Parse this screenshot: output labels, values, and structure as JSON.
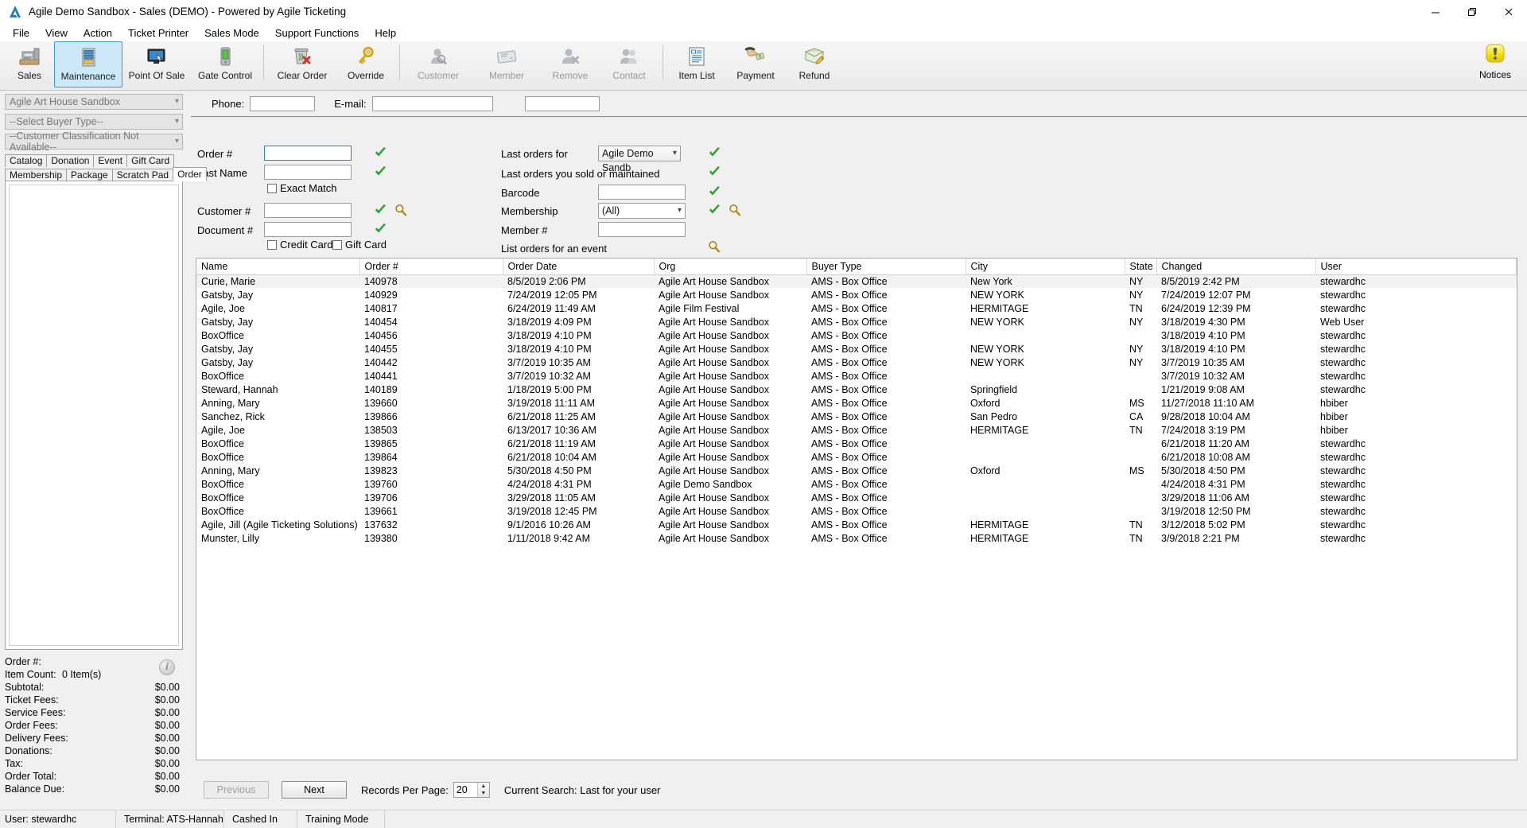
{
  "window": {
    "title": "Agile Demo Sandbox - Sales (DEMO) - Powered by Agile Ticketing",
    "minimize": "─",
    "maximize": "❐",
    "close": "✕"
  },
  "menu": {
    "items": [
      "File",
      "View",
      "Action",
      "Ticket Printer",
      "Sales Mode",
      "Support Functions",
      "Help"
    ]
  },
  "toolbar": {
    "buttons": [
      {
        "label": "Sales",
        "icon": "cash-register-icon",
        "state": "enabled"
      },
      {
        "label": "Maintenance",
        "icon": "server-cabinet-icon",
        "state": "selected"
      },
      {
        "label": "Point Of Sale",
        "icon": "monitor-touch-icon",
        "state": "enabled"
      },
      {
        "label": "Gate Control",
        "icon": "handheld-scanner-icon",
        "state": "enabled"
      },
      {
        "label": "Clear Order",
        "icon": "trash-delete-icon",
        "state": "enabled"
      },
      {
        "label": "Override",
        "icon": "key-icon",
        "state": "enabled"
      },
      {
        "label": "Customer",
        "icon": "person-search-icon",
        "state": "disabled"
      },
      {
        "label": "Member",
        "icon": "membership-card-icon",
        "state": "disabled"
      },
      {
        "label": "Remove",
        "icon": "person-remove-icon",
        "state": "disabled"
      },
      {
        "label": "Contact",
        "icon": "people-contact-icon",
        "state": "disabled"
      },
      {
        "label": "Item List",
        "icon": "document-list-icon",
        "state": "enabled"
      },
      {
        "label": "Payment",
        "icon": "hand-cash-icon",
        "state": "enabled"
      },
      {
        "label": "Refund",
        "icon": "money-pencil-icon",
        "state": "enabled"
      }
    ],
    "notices_label": "Notices"
  },
  "sidebar": {
    "combos": [
      {
        "value": "Agile Art House Sandbox",
        "name": "organization-select"
      },
      {
        "value": "--Select Buyer Type--",
        "name": "buyer-type-select"
      },
      {
        "value": "--Customer Classification Not Available--",
        "name": "customer-classification-select"
      }
    ],
    "tabs_row1": [
      "Catalog",
      "Donation",
      "Event",
      "Gift Card"
    ],
    "tabs_row2": [
      "Membership",
      "Package",
      "Scratch Pad",
      "Order"
    ],
    "active_tab": "Order"
  },
  "totals": {
    "order_number_label": "Order #:",
    "order_number_value": "",
    "item_count_label": "Item Count:",
    "item_count_value": "0 Item(s)",
    "rows": [
      {
        "label": "Subtotal:",
        "value": "$0.00"
      },
      {
        "label": "Ticket Fees:",
        "value": "$0.00"
      },
      {
        "label": "Service Fees:",
        "value": "$0.00"
      },
      {
        "label": "Order Fees:",
        "value": "$0.00"
      },
      {
        "label": "Delivery Fees:",
        "value": "$0.00"
      },
      {
        "label": "Donations:",
        "value": "$0.00"
      },
      {
        "label": "Tax:",
        "value": "$0.00"
      },
      {
        "label": "Order Total:",
        "value": "$0.00"
      },
      {
        "label": "Balance Due:",
        "value": "$0.00"
      }
    ],
    "info_glyph": "i"
  },
  "search": {
    "phone_label": "Phone:",
    "phone_value": "",
    "email_label": "E-mail:",
    "email_value": "",
    "extra_value": "",
    "order_label": "Order #",
    "order_value": "",
    "lastname_label": "Last Name",
    "lastname_value": "",
    "exact_match_label": "Exact Match",
    "customer_label": "Customer #",
    "customer_value": "",
    "document_label": "Document #",
    "document_value": "",
    "credit_card_label": "Credit Card",
    "gift_card_label": "Gift Card",
    "last_orders_for_label": "Last orders for",
    "last_orders_for_value": "Agile Demo Sandb",
    "last_orders_sold_label": "Last orders you sold or maintained",
    "barcode_label": "Barcode",
    "barcode_value": "",
    "membership_label": "Membership",
    "membership_value": "(All)",
    "member_label": "Member #",
    "member_value": "",
    "list_orders_event_label": "List orders for an event"
  },
  "table": {
    "columns": [
      "Name",
      "Order #",
      "Order Date",
      "Org",
      "Buyer Type",
      "City",
      "State",
      "Changed",
      "User"
    ],
    "selected_row_index": 0,
    "rows": [
      [
        "Curie, Marie",
        "140978",
        "8/5/2019 2:06 PM",
        "Agile Art House Sandbox",
        "AMS - Box Office",
        "New York",
        "NY",
        "8/5/2019 2:42 PM",
        "stewardhc"
      ],
      [
        "Gatsby, Jay",
        "140929",
        "7/24/2019 12:05 PM",
        "Agile Art House Sandbox",
        "AMS - Box Office",
        "NEW YORK",
        "NY",
        "7/24/2019 12:07 PM",
        "stewardhc"
      ],
      [
        "Agile, Joe",
        "140817",
        "6/24/2019 11:49 AM",
        "Agile Film Festival",
        "AMS - Box Office",
        "HERMITAGE",
        "TN",
        "6/24/2019 12:39 PM",
        "stewardhc"
      ],
      [
        "Gatsby, Jay",
        "140454",
        "3/18/2019 4:09 PM",
        "Agile Art House Sandbox",
        "AMS - Box Office",
        "NEW YORK",
        "NY",
        "3/18/2019 4:30 PM",
        "Web User"
      ],
      [
        "BoxOffice",
        "140456",
        "3/18/2019 4:10 PM",
        "Agile Art House Sandbox",
        "AMS - Box Office",
        "",
        "",
        "3/18/2019 4:10 PM",
        "stewardhc"
      ],
      [
        "Gatsby, Jay",
        "140455",
        "3/18/2019 4:10 PM",
        "Agile Art House Sandbox",
        "AMS - Box Office",
        "NEW YORK",
        "NY",
        "3/18/2019 4:10 PM",
        "stewardhc"
      ],
      [
        "Gatsby, Jay",
        "140442",
        "3/7/2019 10:35 AM",
        "Agile Art House Sandbox",
        "AMS - Box Office",
        "NEW YORK",
        "NY",
        "3/7/2019 10:35 AM",
        "stewardhc"
      ],
      [
        "BoxOffice",
        "140441",
        "3/7/2019 10:32 AM",
        "Agile Art House Sandbox",
        "AMS - Box Office",
        "",
        "",
        "3/7/2019 10:32 AM",
        "stewardhc"
      ],
      [
        "Steward, Hannah",
        "140189",
        "1/18/2019 5:00 PM",
        "Agile Art House Sandbox",
        "AMS - Box Office",
        "Springfield",
        "",
        "1/21/2019 9:08 AM",
        "stewardhc"
      ],
      [
        "Anning, Mary",
        "139660",
        "3/19/2018 11:11 AM",
        "Agile Art House Sandbox",
        "AMS - Box Office",
        "Oxford",
        "MS",
        "11/27/2018 11:10 AM",
        "hbiber"
      ],
      [
        "Sanchez, Rick",
        "139866",
        "6/21/2018 11:25 AM",
        "Agile Art House Sandbox",
        "AMS - Box Office",
        "San Pedro",
        "CA",
        "9/28/2018 10:04 AM",
        "hbiber"
      ],
      [
        "Agile, Joe",
        "138503",
        "6/13/2017 10:36 AM",
        "Agile Art House Sandbox",
        "AMS - Box Office",
        "HERMITAGE",
        "TN",
        "7/24/2018 3:19 PM",
        "hbiber"
      ],
      [
        "BoxOffice",
        "139865",
        "6/21/2018 11:19 AM",
        "Agile Art House Sandbox",
        "AMS - Box Office",
        "",
        "",
        "6/21/2018 11:20 AM",
        "stewardhc"
      ],
      [
        "BoxOffice",
        "139864",
        "6/21/2018 10:04 AM",
        "Agile Art House Sandbox",
        "AMS - Box Office",
        "",
        "",
        "6/21/2018 10:08 AM",
        "stewardhc"
      ],
      [
        "Anning, Mary",
        "139823",
        "5/30/2018 4:50 PM",
        "Agile Art House Sandbox",
        "AMS - Box Office",
        "Oxford",
        "MS",
        "5/30/2018 4:50 PM",
        "stewardhc"
      ],
      [
        "BoxOffice",
        "139760",
        "4/24/2018 4:31 PM",
        "Agile Demo Sandbox",
        "AMS - Box Office",
        "",
        "",
        "4/24/2018 4:31 PM",
        "stewardhc"
      ],
      [
        "BoxOffice",
        "139706",
        "3/29/2018 11:05 AM",
        "Agile Art House Sandbox",
        "AMS - Box Office",
        "",
        "",
        "3/29/2018 11:06 AM",
        "stewardhc"
      ],
      [
        "BoxOffice",
        "139661",
        "3/19/2018 12:45 PM",
        "Agile Art House Sandbox",
        "AMS - Box Office",
        "",
        "",
        "3/19/2018 12:50 PM",
        "stewardhc"
      ],
      [
        "Agile, Jill (Agile Ticketing Solutions)",
        "137632",
        "9/1/2016 10:26 AM",
        "Agile Art House Sandbox",
        "AMS - Box Office",
        "HERMITAGE",
        "TN",
        "3/12/2018 5:02 PM",
        "stewardhc"
      ],
      [
        "Munster, Lilly",
        "139380",
        "1/11/2018 9:42 AM",
        "Agile Art House Sandbox",
        "AMS - Box Office",
        "HERMITAGE",
        "TN",
        "3/9/2018 2:21 PM",
        "stewardhc"
      ]
    ]
  },
  "pager": {
    "previous_label": "Previous",
    "next_label": "Next",
    "records_per_page_label": "Records Per Page:",
    "records_per_page_value": "20",
    "current_search_label": "Current Search: Last for your user"
  },
  "status": {
    "user": "User:  stewardhc",
    "terminal": "Terminal: ATS-Hannah",
    "cashed": "Cashed In",
    "mode": "Training Mode"
  },
  "colors": {
    "accent_blue": "#3c99d4",
    "selection_bg": "#cde8f9",
    "check_green": "#2e9e36",
    "notices_yellow": "#f2e01a"
  }
}
